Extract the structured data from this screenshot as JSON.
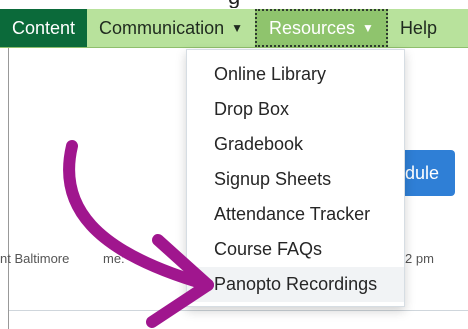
{
  "top_title_fragment": "g",
  "navbar": {
    "items": [
      {
        "label": "Content",
        "state": "active"
      },
      {
        "label": "Communication",
        "caret": "▼"
      },
      {
        "label": "Resources",
        "caret": "▼",
        "state": "open"
      },
      {
        "label": "Help"
      }
    ]
  },
  "dropdown": {
    "items": [
      {
        "label": "Online Library"
      },
      {
        "label": "Drop Box"
      },
      {
        "label": "Gradebook"
      },
      {
        "label": "Signup Sheets"
      },
      {
        "label": "Attendance Tracker"
      },
      {
        "label": "Course FAQs"
      },
      {
        "label": "Panopto Recordings",
        "highlighted": true
      }
    ]
  },
  "background": {
    "button_partial_label": "dule",
    "row_left_text": "nt Baltimore",
    "row_label_text": "me:",
    "row_right_text": "2 pm"
  },
  "annotation": {
    "description": "magenta arrow pointing to Panopto Recordings",
    "color": "#a0168e"
  },
  "colors": {
    "nav_bg": "#b8e29c",
    "nav_active_bg": "#0b6a3a",
    "nav_open_bg": "#8fc46d",
    "button_blue": "#2f7fd6"
  }
}
